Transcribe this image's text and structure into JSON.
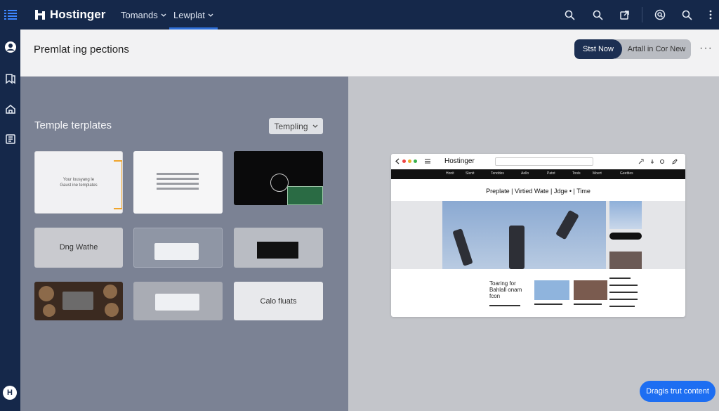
{
  "brand": {
    "name": "Hostinger"
  },
  "topbar": {
    "tabs": [
      {
        "label": "Tomands",
        "active": false
      },
      {
        "label": "Lewplat",
        "active": true
      }
    ],
    "icons": [
      "search-icon",
      "zoom-icon",
      "external-link-icon",
      "search-circle-icon",
      "search-alt-icon",
      "more-vert-icon"
    ]
  },
  "rail": {
    "icons": [
      "menu-list-icon",
      "user-circle-icon",
      "bookmarks-icon",
      "home-icon",
      "document-list-icon"
    ],
    "avatar_letter": "H"
  },
  "header": {
    "title": "Premlat ing pections",
    "primary_button": "Stst Now",
    "secondary_button": "Artall in Cor New",
    "more_label": "···"
  },
  "left_panel": {
    "title": "Temple terplates",
    "dropdown": "Templing",
    "templates": [
      {
        "caption": "Your lousyang le Gaust ine templates"
      },
      {
        "caption": ""
      },
      {
        "caption": ""
      },
      {
        "caption": "Dng Wathe"
      },
      {
        "caption": ""
      },
      {
        "caption": ""
      },
      {
        "caption": ""
      },
      {
        "caption": ""
      },
      {
        "caption": "Calo fluats"
      }
    ]
  },
  "preview": {
    "brand": "Hostinger",
    "nav": [
      "Honit",
      "Slenit",
      "Tenddes",
      "Aello",
      "Patot",
      "Tools",
      "Moert",
      "Geetties"
    ],
    "headline": "Preplate  |  Virtied Wate  |  Jdge  •  |  Time",
    "story_title": "Toaring for Bahlall onam fcon"
  },
  "colors": {
    "navy": "#15284a",
    "accent_blue": "#1d6ef2",
    "selection_orange": "#f0a52c"
  },
  "cta": {
    "label": "Dragis trut content"
  }
}
